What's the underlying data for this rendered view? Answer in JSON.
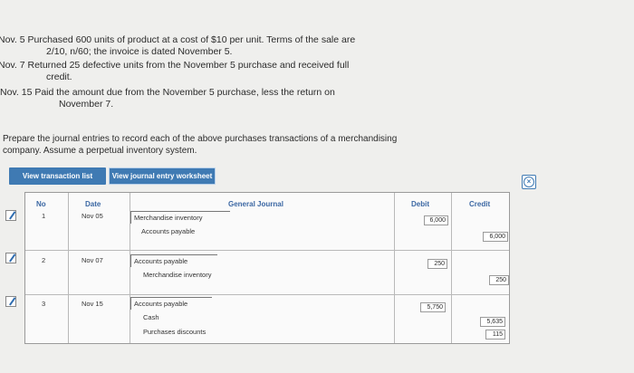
{
  "problem": {
    "line1": "Nov. 5 Purchased 600 units of product at a cost of $10 per unit. Terms of the sale are",
    "line1b": "2/10, n/60; the invoice is dated November 5.",
    "line2": "Nov. 7 Returned 25 defective units from the November 5 purchase and received full",
    "line2b": "credit.",
    "line3": "Nov. 15 Paid the amount due from the November 5 purchase, less the return on",
    "line3b": "November 7."
  },
  "instructions": "Prepare the journal entries to record each of the above purchases transactions of a merchandising company. Assume a perpetual inventory system.",
  "buttons": {
    "transaction_list": "View transaction list",
    "journal_worksheet": "View journal entry worksheet"
  },
  "journal": {
    "headers": {
      "no": "No",
      "date": "Date",
      "general_journal": "General Journal",
      "debit": "Debit",
      "credit": "Credit"
    },
    "entries": [
      {
        "no": "1",
        "date": "Nov 05",
        "debit_account": "Merchandise inventory",
        "credit_account": "Accounts payable",
        "debit_amount": "6,000",
        "credit_amount": "6,000"
      },
      {
        "no": "2",
        "date": "Nov 07",
        "debit_account": "Accounts payable",
        "credit_account": "Merchandise inventory",
        "debit_amount": "250",
        "credit_amount": "250"
      },
      {
        "no": "3",
        "date": "Nov 15",
        "debit_account": "Accounts payable",
        "credit_account": "Cash",
        "credit_account2": "Purchases discounts",
        "debit_amount": "5,750",
        "credit_amount": "5,635",
        "credit_amount2": "115"
      }
    ]
  }
}
